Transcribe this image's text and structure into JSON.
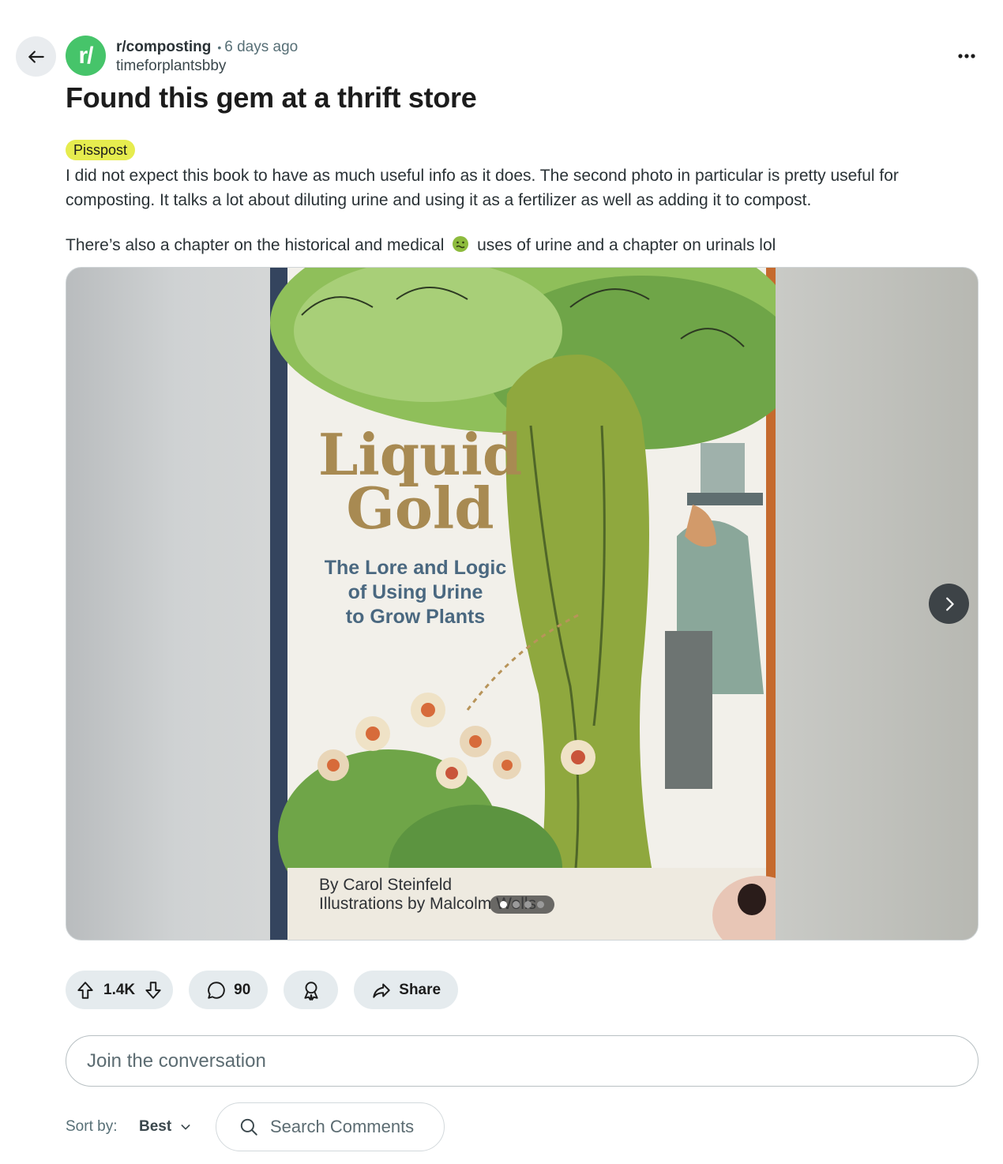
{
  "post": {
    "subreddit": "r/composting",
    "subreddit_avatar_text": "r/",
    "time_ago": "6 days ago",
    "separator": "•",
    "author": "timeforplantsbby",
    "title": "Found this gem at a thrift store",
    "flair": "Pisspost",
    "body_paragraph_1": "I did not expect this book to have as much useful info as it does. The second photo in particular is pretty useful for composting. It talks a lot about diluting urine and using it as a fertilizer as well as adding it to compost.",
    "body_paragraph_2a": "There’s also a chapter on the historical and medical",
    "body_paragraph_2b": "uses of urine and a chapter on urinals lol"
  },
  "gallery": {
    "image_count": 4,
    "current_index": 1,
    "book": {
      "title_line1": "Liquid",
      "title_line2": "Gold",
      "subtitle_line1": "The Lore and Logic",
      "subtitle_line2": "of Using Urine",
      "subtitle_line3": "to Grow Plants",
      "author_line": "By Carol Steinfeld",
      "illustrator_line": "Illustrations by Malcolm Wells"
    }
  },
  "actions": {
    "vote_count": "1.4K",
    "comment_count": "90",
    "share_label": "Share"
  },
  "comments": {
    "join_placeholder": "Join the conversation",
    "sort_label": "Sort by:",
    "sort_value": "Best",
    "search_placeholder": "Search Comments"
  },
  "colors": {
    "subreddit_avatar": "#46c46a",
    "flair_background": "#e6ec4e",
    "pill_background": "#e5ebee"
  },
  "icons": [
    "back-arrow-icon",
    "more-horizontal-icon",
    "upvote-icon",
    "downvote-icon",
    "comment-icon",
    "award-icon",
    "share-icon",
    "chevron-right-icon",
    "chevron-down-icon",
    "search-icon",
    "nauseated-face-emoji"
  ]
}
